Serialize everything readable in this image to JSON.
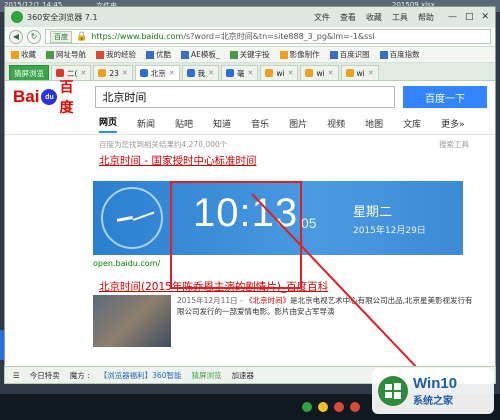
{
  "desktop": {
    "topbar_left": "2015/12/1 14:45",
    "topbar_mid": "文件夹",
    "topbar_right": "201509.xlsx"
  },
  "window": {
    "title": "360安全浏览器 7.1",
    "menu": [
      "文件",
      "查看",
      "收藏",
      "工具",
      "帮助"
    ],
    "controls": [
      "—",
      "□",
      "✕"
    ]
  },
  "addressbar": {
    "site_tag": "百度",
    "url": "https://www.baidu.com",
    "url_rest": "/s?word=北京时间&tn=site888_3_pg&lm=-1&ssl"
  },
  "bookmarks": [
    {
      "label": "收藏",
      "icon": "star-icon"
    },
    {
      "label": "网址导航",
      "icon": "nav-icon"
    },
    {
      "label": "我的经验",
      "icon": "exp-icon"
    },
    {
      "label": "优酷",
      "icon": "youku-icon"
    },
    {
      "label": "AE模板_",
      "icon": "ae-icon"
    },
    {
      "label": "关键字投",
      "icon": "key-icon"
    },
    {
      "label": "影像制作",
      "icon": "video-icon"
    },
    {
      "label": "百度识图",
      "icon": "baidu-icon"
    },
    {
      "label": "百度指数",
      "icon": "index-icon"
    }
  ],
  "tabs": [
    {
      "label": "猜屏浏览",
      "kind": "first"
    },
    {
      "label": "二(",
      "kind": "normal"
    },
    {
      "label": "23",
      "kind": "normal"
    },
    {
      "label": "北京",
      "kind": "active"
    },
    {
      "label": "我",
      "kind": "normal"
    },
    {
      "label": "毫",
      "kind": "normal"
    },
    {
      "label": "wi",
      "kind": "normal"
    },
    {
      "label": "wi",
      "kind": "normal"
    },
    {
      "label": "wi",
      "kind": "normal"
    }
  ],
  "search": {
    "logo_en": "Bai",
    "logo_paw": "du",
    "logo_cn": "百度",
    "query": "北京时间",
    "button": "百度一下"
  },
  "nav_tabs": [
    "网页",
    "新闻",
    "贴吧",
    "知道",
    "音乐",
    "图片",
    "视频",
    "地图",
    "文库",
    "更多»"
  ],
  "result_meta": {
    "count": "百度为您找到相关结果约4,270,000个",
    "tools": "搜索工具"
  },
  "result1": {
    "title": "北京时间 - 国家授时中心标准时间",
    "url": "open.baidu.com/"
  },
  "clock": {
    "time": "10:13",
    "seconds": "05",
    "weekday": "星期二",
    "date": "2015年12月29日"
  },
  "result2": {
    "title": "北京时间(2015年陈乔恩主演的剧情片)_百度百科",
    "date_prefix": "2015年12月11日 - ",
    "highlight": "《北京时间》",
    "snippet": "是北京电视艺术中心有限公司出品,北京星美影视发行有限公司发行的一部爱情电影。影片由安占军导演"
  },
  "statusbar": {
    "items": [
      "今日特卖",
      "魔方 :",
      "【浏览器福利】360智能",
      "猜屏浏览",
      "加速器"
    ]
  },
  "watermark": {
    "line1": "Win10",
    "line2": "系统之家"
  }
}
